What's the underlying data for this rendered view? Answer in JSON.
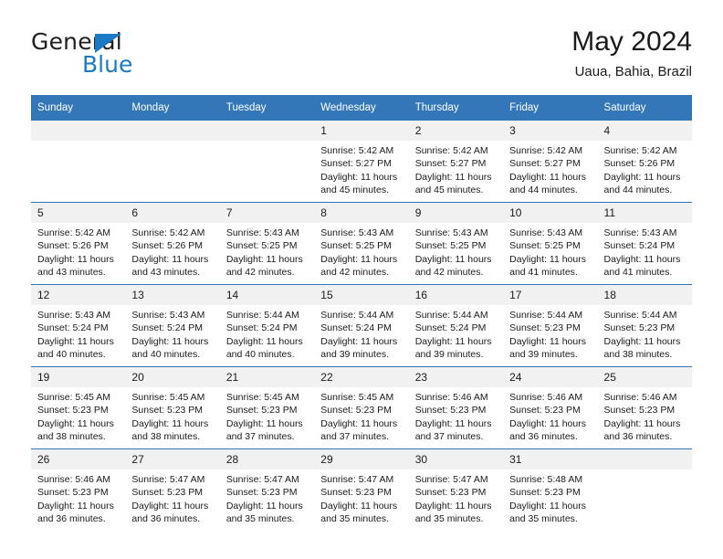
{
  "brand": {
    "name_top": "General",
    "name_bottom": "Blue",
    "triangle_icon": "triangle-icon",
    "accent_color": "#1a7bc4"
  },
  "header": {
    "title": "May 2024",
    "subtitle": "Uaua, Bahia, Brazil"
  },
  "theme": {
    "header_blue": "#3377b8",
    "daynum_band": "#f1f1f1",
    "text": "#1a1a1a"
  },
  "calendar": {
    "weekday_headers": [
      "Sunday",
      "Monday",
      "Tuesday",
      "Wednesday",
      "Thursday",
      "Friday",
      "Saturday"
    ],
    "weeks": [
      [
        {
          "day": "",
          "sunrise": "",
          "sunset": "",
          "daylight_line1": "",
          "daylight_line2": "",
          "empty": true
        },
        {
          "day": "",
          "sunrise": "",
          "sunset": "",
          "daylight_line1": "",
          "daylight_line2": "",
          "empty": true
        },
        {
          "day": "",
          "sunrise": "",
          "sunset": "",
          "daylight_line1": "",
          "daylight_line2": "",
          "empty": true
        },
        {
          "day": "1",
          "sunrise": "Sunrise: 5:42 AM",
          "sunset": "Sunset: 5:27 PM",
          "daylight_line1": "Daylight: 11 hours",
          "daylight_line2": "and 45 minutes.",
          "empty": false
        },
        {
          "day": "2",
          "sunrise": "Sunrise: 5:42 AM",
          "sunset": "Sunset: 5:27 PM",
          "daylight_line1": "Daylight: 11 hours",
          "daylight_line2": "and 45 minutes.",
          "empty": false
        },
        {
          "day": "3",
          "sunrise": "Sunrise: 5:42 AM",
          "sunset": "Sunset: 5:27 PM",
          "daylight_line1": "Daylight: 11 hours",
          "daylight_line2": "and 44 minutes.",
          "empty": false
        },
        {
          "day": "4",
          "sunrise": "Sunrise: 5:42 AM",
          "sunset": "Sunset: 5:26 PM",
          "daylight_line1": "Daylight: 11 hours",
          "daylight_line2": "and 44 minutes.",
          "empty": false
        }
      ],
      [
        {
          "day": "5",
          "sunrise": "Sunrise: 5:42 AM",
          "sunset": "Sunset: 5:26 PM",
          "daylight_line1": "Daylight: 11 hours",
          "daylight_line2": "and 43 minutes.",
          "empty": false
        },
        {
          "day": "6",
          "sunrise": "Sunrise: 5:42 AM",
          "sunset": "Sunset: 5:26 PM",
          "daylight_line1": "Daylight: 11 hours",
          "daylight_line2": "and 43 minutes.",
          "empty": false
        },
        {
          "day": "7",
          "sunrise": "Sunrise: 5:43 AM",
          "sunset": "Sunset: 5:25 PM",
          "daylight_line1": "Daylight: 11 hours",
          "daylight_line2": "and 42 minutes.",
          "empty": false
        },
        {
          "day": "8",
          "sunrise": "Sunrise: 5:43 AM",
          "sunset": "Sunset: 5:25 PM",
          "daylight_line1": "Daylight: 11 hours",
          "daylight_line2": "and 42 minutes.",
          "empty": false
        },
        {
          "day": "9",
          "sunrise": "Sunrise: 5:43 AM",
          "sunset": "Sunset: 5:25 PM",
          "daylight_line1": "Daylight: 11 hours",
          "daylight_line2": "and 42 minutes.",
          "empty": false
        },
        {
          "day": "10",
          "sunrise": "Sunrise: 5:43 AM",
          "sunset": "Sunset: 5:25 PM",
          "daylight_line1": "Daylight: 11 hours",
          "daylight_line2": "and 41 minutes.",
          "empty": false
        },
        {
          "day": "11",
          "sunrise": "Sunrise: 5:43 AM",
          "sunset": "Sunset: 5:24 PM",
          "daylight_line1": "Daylight: 11 hours",
          "daylight_line2": "and 41 minutes.",
          "empty": false
        }
      ],
      [
        {
          "day": "12",
          "sunrise": "Sunrise: 5:43 AM",
          "sunset": "Sunset: 5:24 PM",
          "daylight_line1": "Daylight: 11 hours",
          "daylight_line2": "and 40 minutes.",
          "empty": false
        },
        {
          "day": "13",
          "sunrise": "Sunrise: 5:43 AM",
          "sunset": "Sunset: 5:24 PM",
          "daylight_line1": "Daylight: 11 hours",
          "daylight_line2": "and 40 minutes.",
          "empty": false
        },
        {
          "day": "14",
          "sunrise": "Sunrise: 5:44 AM",
          "sunset": "Sunset: 5:24 PM",
          "daylight_line1": "Daylight: 11 hours",
          "daylight_line2": "and 40 minutes.",
          "empty": false
        },
        {
          "day": "15",
          "sunrise": "Sunrise: 5:44 AM",
          "sunset": "Sunset: 5:24 PM",
          "daylight_line1": "Daylight: 11 hours",
          "daylight_line2": "and 39 minutes.",
          "empty": false
        },
        {
          "day": "16",
          "sunrise": "Sunrise: 5:44 AM",
          "sunset": "Sunset: 5:24 PM",
          "daylight_line1": "Daylight: 11 hours",
          "daylight_line2": "and 39 minutes.",
          "empty": false
        },
        {
          "day": "17",
          "sunrise": "Sunrise: 5:44 AM",
          "sunset": "Sunset: 5:23 PM",
          "daylight_line1": "Daylight: 11 hours",
          "daylight_line2": "and 39 minutes.",
          "empty": false
        },
        {
          "day": "18",
          "sunrise": "Sunrise: 5:44 AM",
          "sunset": "Sunset: 5:23 PM",
          "daylight_line1": "Daylight: 11 hours",
          "daylight_line2": "and 38 minutes.",
          "empty": false
        }
      ],
      [
        {
          "day": "19",
          "sunrise": "Sunrise: 5:45 AM",
          "sunset": "Sunset: 5:23 PM",
          "daylight_line1": "Daylight: 11 hours",
          "daylight_line2": "and 38 minutes.",
          "empty": false
        },
        {
          "day": "20",
          "sunrise": "Sunrise: 5:45 AM",
          "sunset": "Sunset: 5:23 PM",
          "daylight_line1": "Daylight: 11 hours",
          "daylight_line2": "and 38 minutes.",
          "empty": false
        },
        {
          "day": "21",
          "sunrise": "Sunrise: 5:45 AM",
          "sunset": "Sunset: 5:23 PM",
          "daylight_line1": "Daylight: 11 hours",
          "daylight_line2": "and 37 minutes.",
          "empty": false
        },
        {
          "day": "22",
          "sunrise": "Sunrise: 5:45 AM",
          "sunset": "Sunset: 5:23 PM",
          "daylight_line1": "Daylight: 11 hours",
          "daylight_line2": "and 37 minutes.",
          "empty": false
        },
        {
          "day": "23",
          "sunrise": "Sunrise: 5:46 AM",
          "sunset": "Sunset: 5:23 PM",
          "daylight_line1": "Daylight: 11 hours",
          "daylight_line2": "and 37 minutes.",
          "empty": false
        },
        {
          "day": "24",
          "sunrise": "Sunrise: 5:46 AM",
          "sunset": "Sunset: 5:23 PM",
          "daylight_line1": "Daylight: 11 hours",
          "daylight_line2": "and 36 minutes.",
          "empty": false
        },
        {
          "day": "25",
          "sunrise": "Sunrise: 5:46 AM",
          "sunset": "Sunset: 5:23 PM",
          "daylight_line1": "Daylight: 11 hours",
          "daylight_line2": "and 36 minutes.",
          "empty": false
        }
      ],
      [
        {
          "day": "26",
          "sunrise": "Sunrise: 5:46 AM",
          "sunset": "Sunset: 5:23 PM",
          "daylight_line1": "Daylight: 11 hours",
          "daylight_line2": "and 36 minutes.",
          "empty": false
        },
        {
          "day": "27",
          "sunrise": "Sunrise: 5:47 AM",
          "sunset": "Sunset: 5:23 PM",
          "daylight_line1": "Daylight: 11 hours",
          "daylight_line2": "and 36 minutes.",
          "empty": false
        },
        {
          "day": "28",
          "sunrise": "Sunrise: 5:47 AM",
          "sunset": "Sunset: 5:23 PM",
          "daylight_line1": "Daylight: 11 hours",
          "daylight_line2": "and 35 minutes.",
          "empty": false
        },
        {
          "day": "29",
          "sunrise": "Sunrise: 5:47 AM",
          "sunset": "Sunset: 5:23 PM",
          "daylight_line1": "Daylight: 11 hours",
          "daylight_line2": "and 35 minutes.",
          "empty": false
        },
        {
          "day": "30",
          "sunrise": "Sunrise: 5:47 AM",
          "sunset": "Sunset: 5:23 PM",
          "daylight_line1": "Daylight: 11 hours",
          "daylight_line2": "and 35 minutes.",
          "empty": false
        },
        {
          "day": "31",
          "sunrise": "Sunrise: 5:48 AM",
          "sunset": "Sunset: 5:23 PM",
          "daylight_line1": "Daylight: 11 hours",
          "daylight_line2": "and 35 minutes.",
          "empty": false
        },
        {
          "day": "",
          "sunrise": "",
          "sunset": "",
          "daylight_line1": "",
          "daylight_line2": "",
          "empty": true
        }
      ]
    ]
  }
}
